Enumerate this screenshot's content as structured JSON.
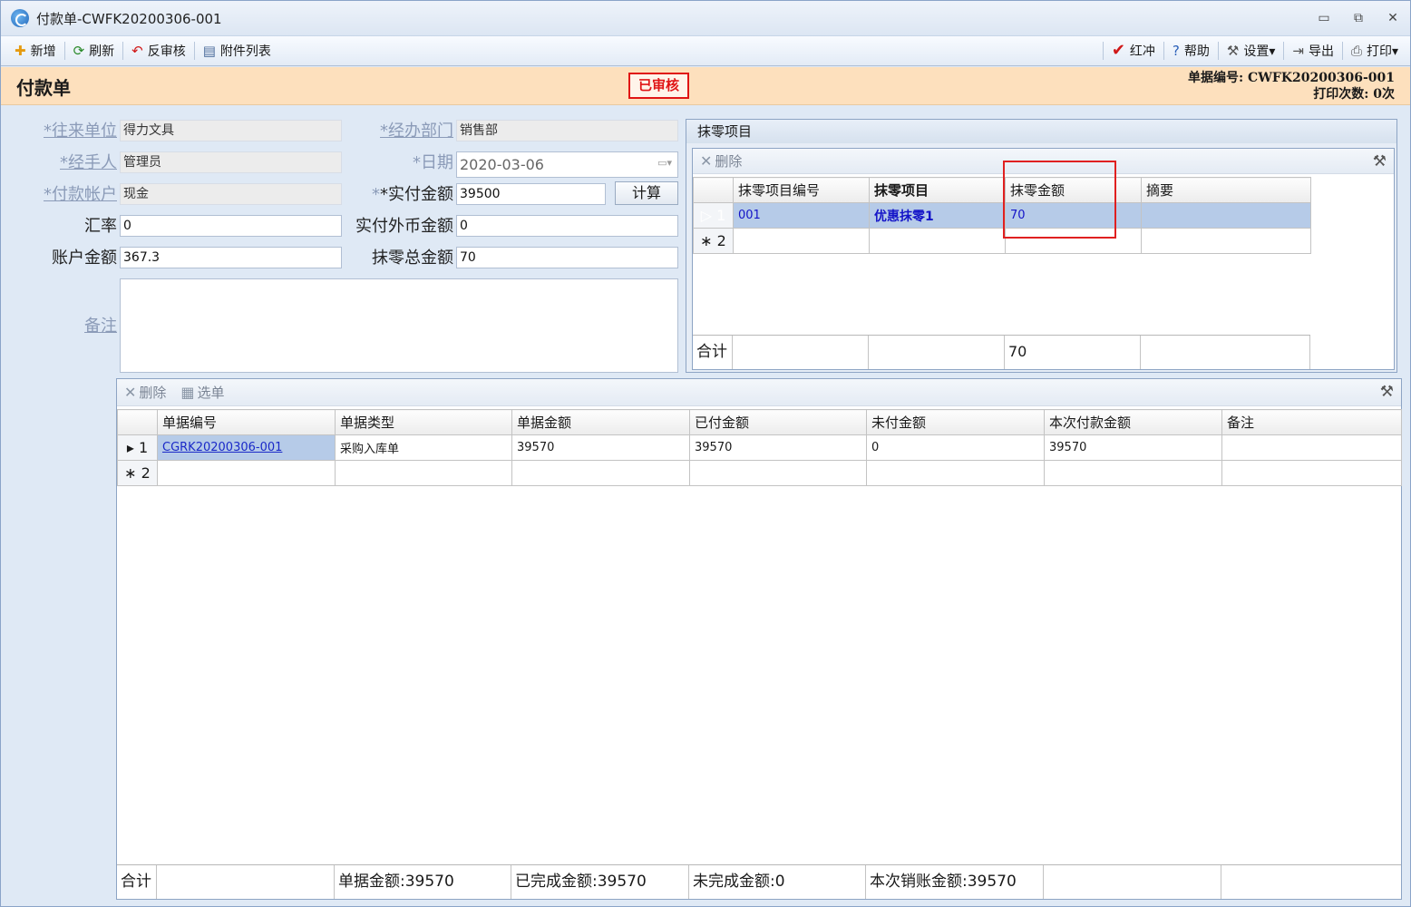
{
  "window": {
    "title": "付款单-CWFK20200306-001",
    "minimize": "▭",
    "restore": "⧉",
    "close": "✕"
  },
  "toolbar": {
    "left": [
      {
        "label": "新增",
        "icon": "plus-icon",
        "glyph": "✚",
        "color": "#e59a10"
      },
      {
        "label": "刷新",
        "icon": "refresh-icon",
        "glyph": "⟳",
        "color": "#2a8a2a"
      },
      {
        "label": "反审核",
        "icon": "undo-icon",
        "glyph": "↶",
        "color": "#d01818"
      },
      {
        "label": "附件列表",
        "icon": "attachment-icon",
        "glyph": "▤",
        "color": "#4a6a9a"
      }
    ],
    "right": [
      {
        "label": "红冲",
        "icon": "checkmark-icon",
        "glyph": "✔",
        "color": "#d01818"
      },
      {
        "label": "帮助",
        "icon": "help-icon",
        "glyph": "❓",
        "color": "#2a5fb8"
      },
      {
        "label": "设置▾",
        "icon": "settings-icon",
        "glyph": "⚒",
        "color": "#555"
      },
      {
        "label": "导出",
        "icon": "export-icon",
        "glyph": "⇥",
        "color": "#555"
      },
      {
        "label": "打印▾",
        "icon": "print-icon",
        "glyph": "⎙",
        "color": "#555"
      }
    ]
  },
  "header": {
    "title": "付款单",
    "status_stamp": "已审核",
    "doc_no": "单据编号: CWFK20200306-001",
    "print_count": "打印次数: 0次",
    "band_color": "#fde0bd",
    "stamp_color": "#e01515"
  },
  "form": {
    "partner_label": "*往来单位",
    "partner": "得力文具",
    "dept_label": "*经办部门",
    "dept": "销售部",
    "handler_label": "*经手人",
    "handler": "管理员",
    "date_label": "*日期",
    "date": "2020-03-06",
    "account_label": "*付款帐户",
    "account": "现金",
    "paid_label": "*实付金额",
    "paid": "39500",
    "calc_btn": "计算",
    "rate_label": "汇率",
    "rate": "0",
    "foreign_label": "实付外币金额",
    "foreign": "0",
    "balance_label": "账户金额",
    "balance": "367.3",
    "rounding_total_label": "抹零总金额",
    "rounding_total": "70",
    "remark_label": "备注",
    "remark": ""
  },
  "rounding": {
    "title": "抹零项目",
    "delete": "删除",
    "columns": [
      "抹零项目编号",
      "抹零项目",
      "抹零金额",
      "摘要"
    ],
    "rows": [
      {
        "rn": "1",
        "marker": "▷",
        "code": "001",
        "item": "优惠抹零1",
        "amount": "70",
        "note": ""
      },
      {
        "rn": "2",
        "marker": "∗",
        "code": "",
        "item": "",
        "amount": "",
        "note": ""
      }
    ],
    "footer": {
      "label": "合计",
      "amount": "70"
    }
  },
  "detail": {
    "delete": "删除",
    "select": "选单",
    "columns": [
      "单据编号",
      "单据类型",
      "单据金额",
      "已付金额",
      "未付金额",
      "本次付款金额",
      "备注"
    ],
    "rows": [
      {
        "rn": "1",
        "marker": "▸",
        "doc_no": "CGRK20200306-001",
        "type": "采购入库单",
        "amount": "39570",
        "paid": "39570",
        "unpaid": "0",
        "this_pay": "39570",
        "note": ""
      },
      {
        "rn": "2",
        "marker": "∗",
        "doc_no": "",
        "type": "",
        "amount": "",
        "paid": "",
        "unpaid": "",
        "this_pay": "",
        "note": ""
      }
    ],
    "footer": {
      "label": "合计",
      "amount": "单据金额:39570",
      "done": "已完成金额:39570",
      "undone": "未完成金额:0",
      "writeoff": "本次销账金额:39570"
    }
  }
}
